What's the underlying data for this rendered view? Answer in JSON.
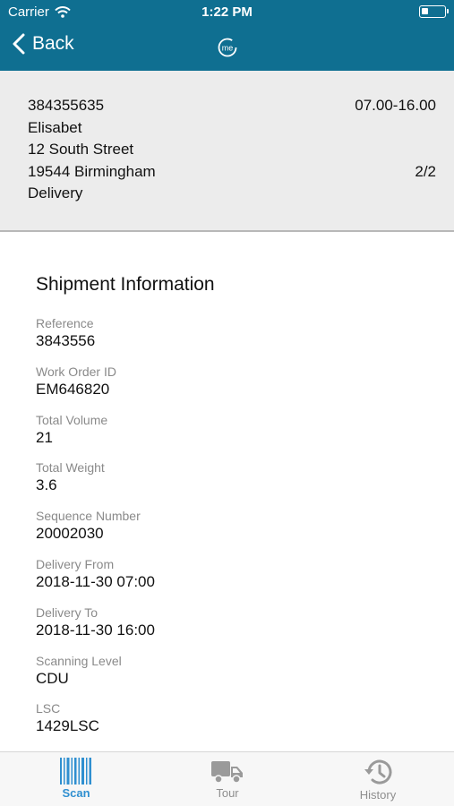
{
  "status_bar": {
    "carrier": "Carrier",
    "time": "1:22 PM"
  },
  "nav": {
    "back_label": "Back",
    "logo_text": "me"
  },
  "header": {
    "order_number": "384355635",
    "time_window": "07.00-16.00",
    "name": "Elisabet",
    "street": "12 South Street",
    "city": "19544 Birmingham",
    "count": "2/2",
    "type": "Delivery"
  },
  "shipment": {
    "title": "Shipment Information",
    "fields": [
      {
        "label": "Reference",
        "value": "3843556"
      },
      {
        "label": "Work Order ID",
        "value": "EM646820"
      },
      {
        "label": "Total Volume",
        "value": "21"
      },
      {
        "label": "Total Weight",
        "value": "3.6"
      },
      {
        "label": "Sequence Number",
        "value": "20002030"
      },
      {
        "label": "Delivery From",
        "value": "2018-11-30 07:00"
      },
      {
        "label": "Delivery To",
        "value": "2018-11-30 16:00"
      },
      {
        "label": "Scanning Level",
        "value": "CDU"
      },
      {
        "label": "LSC",
        "value": "1429LSC"
      }
    ]
  },
  "tabs": [
    {
      "label": "Scan",
      "icon": "barcode-icon",
      "active": true
    },
    {
      "label": "Tour",
      "icon": "truck-icon",
      "active": false
    },
    {
      "label": "History",
      "icon": "history-icon",
      "active": false
    }
  ],
  "colors": {
    "primary": "#0f6f91",
    "header_bg": "#ececec",
    "tab_active": "#2f8fd0",
    "tab_inactive": "#8e8e8e"
  }
}
